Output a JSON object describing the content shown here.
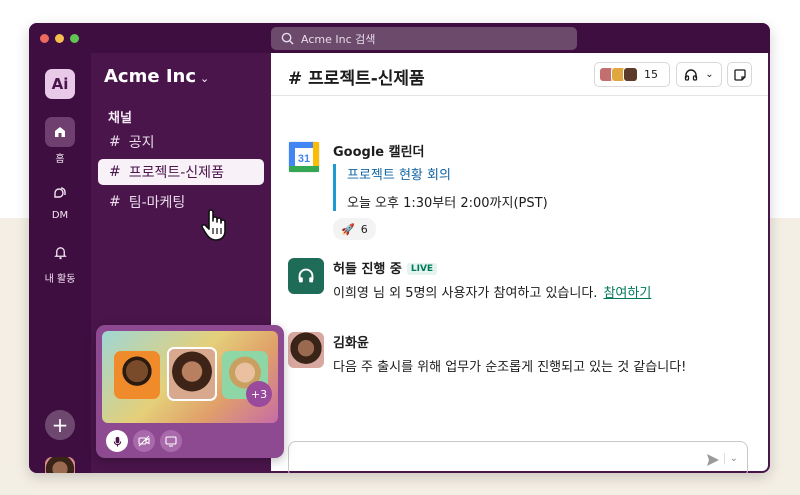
{
  "search": {
    "placeholder": "Acme Inc 검색"
  },
  "workspace": {
    "initials": "Ai",
    "name": "Acme Inc"
  },
  "rail": {
    "home_label": "홈",
    "dm_label": "DM",
    "activity_label": "내 활동"
  },
  "sidebar": {
    "section_label": "채널",
    "channels": [
      {
        "prefix": "#",
        "name": "공지"
      },
      {
        "prefix": "#",
        "name": "프로젝트-신제품"
      },
      {
        "prefix": "#",
        "name": "팀-마케팅"
      }
    ]
  },
  "huddle_card": {
    "extra_count": "+3"
  },
  "channel_header": {
    "title": "# 프로젝트-신제품",
    "member_count": "15"
  },
  "messages": [
    {
      "sender": "Google 캘린더",
      "calendar_day": "31",
      "event_link": "프로젝트 현황 회의",
      "event_time": "오늘 오후 1:30부터 2:00까지(PST)",
      "reaction_count": "6"
    },
    {
      "sender": "허들 진행 중",
      "badge": "LIVE",
      "text": "이희영 님 외 5명의 사용자가 참여하고 있습니다.",
      "link": "참여하기"
    },
    {
      "sender": "김화윤",
      "text": "다음 주 출시를 위해 업무가 순조롭게 진행되고 있는 것 같습니다!"
    }
  ],
  "colors": {
    "aubergine": "#4a154b",
    "rail": "#3f0e40",
    "link_blue": "#1264a3",
    "huddle_green": "#007a5a",
    "quote_bar": "#1d9bd1"
  }
}
